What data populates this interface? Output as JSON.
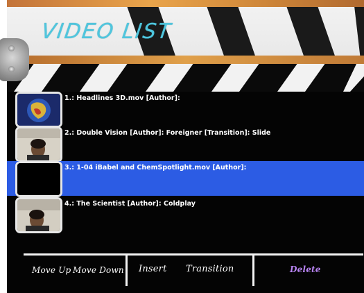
{
  "header": {
    "title": "VIDEO LIST"
  },
  "videos": [
    {
      "label": "1.: Headlines 3D.mov [Author]:",
      "thumbnail": "globe-icon",
      "selected": false
    },
    {
      "label": "2.: Double Vision [Author]: Foreigner [Transition]: Slide",
      "thumbnail": "webcam-face",
      "selected": false
    },
    {
      "label": "3.: 1-04 iBabel and ChemSpotlight.mov [Author]:",
      "thumbnail": "black-frame",
      "selected": true
    },
    {
      "label": "4.: The Scientist [Author]: Coldplay",
      "thumbnail": "webcam-face",
      "selected": false
    }
  ],
  "toolbar": {
    "move_up": "Move Up",
    "move_down": "Move Down",
    "insert": "Insert",
    "transition": "Transition",
    "delete": "Delete"
  },
  "colors": {
    "board": "#040404",
    "selection": "#2c5ce4",
    "title": "#4fc6de",
    "delete": "#b884f2",
    "wood": "#d0883a"
  }
}
